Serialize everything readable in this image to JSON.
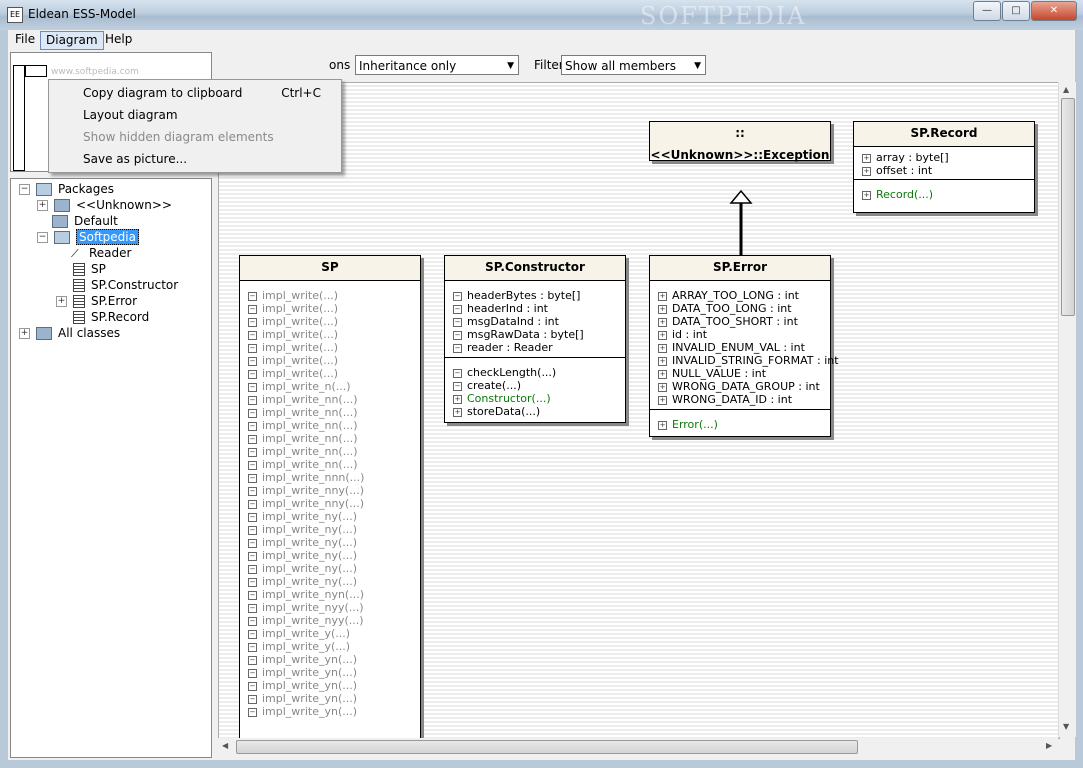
{
  "window": {
    "title": "Eldean ESS-Model",
    "watermark": "SOFTPEDIA",
    "buttons": {
      "minimize": "—",
      "maximize": "□",
      "close": "✕"
    }
  },
  "menu": {
    "file": "File",
    "diagram": "Diagram",
    "help": "Help"
  },
  "diagram_menu": [
    {
      "label": "Copy diagram to clipboard",
      "shortcut": "Ctrl+C",
      "enabled": true
    },
    {
      "label": "Layout diagram",
      "shortcut": "",
      "enabled": true
    },
    {
      "label": "Show hidden diagram elements",
      "shortcut": "",
      "enabled": false
    },
    {
      "label": "Save as picture...",
      "shortcut": "",
      "enabled": true
    }
  ],
  "overview": {
    "watermark": "www.softpedia.com"
  },
  "toolbar": {
    "associations_label": "ons",
    "associations_value": "Inheritance only",
    "filter_label": "Filter",
    "filter_value": "Show all members"
  },
  "tree": {
    "packages": "Packages",
    "unknown": "<<Unknown>>",
    "default": "Default",
    "softpedia": "Softpedia",
    "reader": "Reader",
    "sp": "SP",
    "sp_constructor": "SP.Constructor",
    "sp_error": "SP.Error",
    "sp_record": "SP.Record",
    "all_classes": "All classes"
  },
  "classes": {
    "exception": {
      "title": "::<<Unknown>>::Exception"
    },
    "record": {
      "title": "SP.Record",
      "fields": [
        "array : byte[]",
        "offset : int"
      ],
      "methods": [
        "Record(...)"
      ]
    },
    "sp": {
      "title": "SP",
      "methods": [
        "impl_write(...)",
        "impl_write(...)",
        "impl_write(...)",
        "impl_write(...)",
        "impl_write(...)",
        "impl_write(...)",
        "impl_write(...)",
        "impl_write_n(...)",
        "impl_write_nn(...)",
        "impl_write_nn(...)",
        "impl_write_nn(...)",
        "impl_write_nn(...)",
        "impl_write_nn(...)",
        "impl_write_nn(...)",
        "impl_write_nnn(...)",
        "impl_write_nny(...)",
        "impl_write_nny(...)",
        "impl_write_ny(...)",
        "impl_write_ny(...)",
        "impl_write_ny(...)",
        "impl_write_ny(...)",
        "impl_write_ny(...)",
        "impl_write_ny(...)",
        "impl_write_nyn(...)",
        "impl_write_nyy(...)",
        "impl_write_nyy(...)",
        "impl_write_y(...)",
        "impl_write_y(...)",
        "impl_write_yn(...)",
        "impl_write_yn(...)",
        "impl_write_yn(...)",
        "impl_write_yn(...)",
        "impl_write_yn(...)"
      ]
    },
    "constructor": {
      "title": "SP.Constructor",
      "fields": [
        "headerBytes : byte[]",
        "headerInd : int",
        "msgDataInd : int",
        "msgRawData : byte[]",
        "reader : Reader"
      ],
      "methods": [
        {
          "text": "checkLength(...)",
          "icon": "minus",
          "style": "normal"
        },
        {
          "text": "create(...)",
          "icon": "minus",
          "style": "normal"
        },
        {
          "text": "Constructor(...)",
          "icon": "plus",
          "style": "green"
        },
        {
          "text": "storeData(...)",
          "icon": "plus",
          "style": "normal"
        }
      ]
    },
    "error": {
      "title": "SP.Error",
      "fields": [
        "ARRAY_TOO_LONG : int",
        "DATA_TOO_LONG : int",
        "DATA_TOO_SHORT : int",
        "id : int",
        "INVALID_ENUM_VAL : int",
        "INVALID_STRING_FORMAT : int",
        "NULL_VALUE : int",
        "WRONG_DATA_GROUP : int",
        "WRONG_DATA_ID : int"
      ],
      "methods": [
        "Error(...)"
      ]
    }
  }
}
